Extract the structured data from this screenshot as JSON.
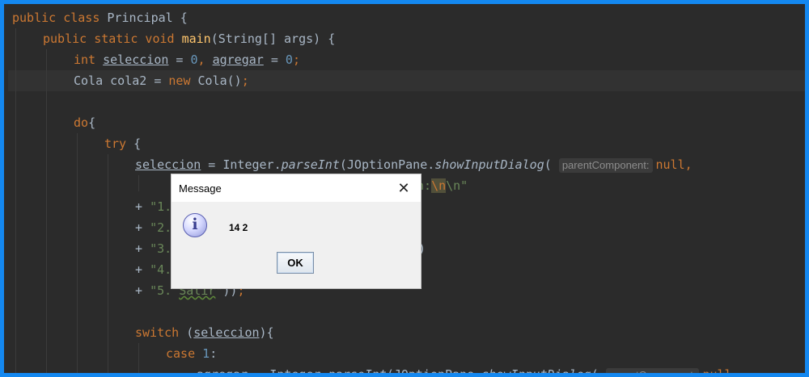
{
  "code": {
    "l1": {
      "t1": "public class ",
      "t2": "Principal {"
    },
    "l2": {
      "t1": "public static void ",
      "t2": "main",
      "t3": "(String[] args) {"
    },
    "l3": {
      "t1": "int ",
      "t2": "seleccion",
      "t3": " = ",
      "t4": "0",
      "t5": ", ",
      "t6": "agregar",
      "t7": " = ",
      "t8": "0",
      "t9": ";"
    },
    "l4": {
      "t1": "Cola cola2 = ",
      "t2": "new ",
      "t3": "Cola()",
      "t4": ";"
    },
    "l5": {
      "t1": "do",
      "t2": "{"
    },
    "l6": {
      "t1": "try ",
      "t2": "{"
    },
    "l7": {
      "t1": "seleccion",
      "t2": " = Integer.",
      "t3": "parseInt",
      "t4": "(JOptionPane.",
      "t5": "showInputDialog",
      "t6": "( ",
      "hint": "parentComponent:",
      "t7": "null",
      "t8": ","
    },
    "l8": {
      "t1": "n:",
      "t2": "\\n",
      "t3": "\\n\""
    },
    "l9": {
      "t1": "+ ",
      "t2": "\"1."
    },
    "l10": {
      "t1": "+ ",
      "t2": "\"2."
    },
    "l11": {
      "t1": "+ ",
      "t2": "\"3.",
      "t3": ")"
    },
    "l12": {
      "t1": "+ ",
      "t2": "\"4."
    },
    "l13": {
      "t1": "+ ",
      "t2": "\"5. ",
      "t3": "Salir",
      "t4": "\"",
      "t5": "))",
      "t6": ";"
    },
    "l14": {
      "t1": "switch ",
      "t2": "(",
      "t3": "seleccion",
      "t4": "){"
    },
    "l15": {
      "t1": "case ",
      "t2": "1",
      "t3": ":"
    },
    "l16": {
      "t1": "agregar",
      "t2": " = Integer.",
      "t3": "parseInt",
      "t4": "(JOptionPane.",
      "t5": "showInputDialog",
      "t6": "( ",
      "hint": "parentComponent:",
      "t7": "null",
      "t8": ","
    }
  },
  "dialog": {
    "title": "Message",
    "message": "14 2",
    "ok_label": "OK",
    "close_glyph": "✕",
    "icon_glyph": "i"
  }
}
